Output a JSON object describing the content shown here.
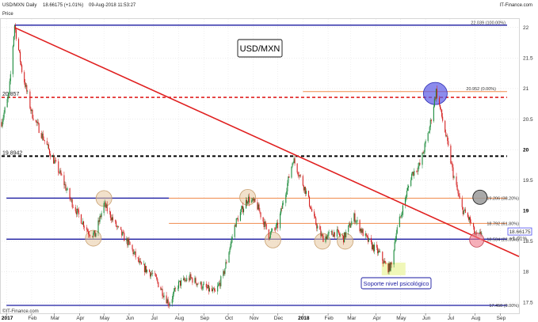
{
  "header": {
    "instrument": "USD/MXN",
    "period": "Daily",
    "quote": "18.66175 (+1.01%)",
    "datetime": "09-Aug-2018 11:53:27",
    "source": "IT-Finance.com",
    "axis_tag": "Price",
    "footer": "©IT-Finance.com"
  },
  "chart_data": {
    "type": "candlestick",
    "title": "USD/MXN",
    "ylim": [
      17.32,
      22.14
    ],
    "y_ticks": [
      17.5,
      18,
      18.5,
      19,
      19.5,
      20,
      20.5,
      21,
      21.5,
      22
    ],
    "y_tick_labels": [
      "17.5",
      "18",
      "18.5",
      "19",
      "19.5",
      "20",
      "20.5",
      "21",
      "21.5",
      "22"
    ],
    "x_labels": [
      "2017",
      "Feb",
      "Mar",
      "Apr",
      "May",
      "Jun",
      "Jul",
      "Aug",
      "Sep",
      "Oct",
      "Nov",
      "Dec",
      "2018",
      "Feb",
      "Mar",
      "Apr",
      "May",
      "Jun",
      "Jul",
      "Aug",
      "Sep"
    ],
    "x_range": [
      "2016-12-26",
      "2018-09-24"
    ],
    "price_path": [
      [
        "2016-12-26",
        20.45
      ],
      [
        "2017-01-04",
        20.9
      ],
      [
        "2017-01-11",
        22.04
      ],
      [
        "2017-01-20",
        21.3
      ],
      [
        "2017-02-01",
        20.6
      ],
      [
        "2017-02-15",
        20.2
      ],
      [
        "2017-03-01",
        19.8
      ],
      [
        "2017-03-10",
        19.55
      ],
      [
        "2017-03-20",
        19.2
      ],
      [
        "2017-04-01",
        18.9
      ],
      [
        "2017-04-12",
        18.65
      ],
      [
        "2017-04-20",
        18.6
      ],
      [
        "2017-05-01",
        19.1
      ],
      [
        "2017-05-08",
        18.95
      ],
      [
        "2017-05-18",
        18.7
      ],
      [
        "2017-06-01",
        18.45
      ],
      [
        "2017-06-15",
        18.1
      ],
      [
        "2017-07-01",
        17.95
      ],
      [
        "2017-07-15",
        17.6
      ],
      [
        "2017-07-20",
        17.48
      ],
      [
        "2017-08-01",
        17.8
      ],
      [
        "2017-08-15",
        17.9
      ],
      [
        "2017-09-01",
        17.75
      ],
      [
        "2017-09-15",
        17.65
      ],
      [
        "2017-09-25",
        17.95
      ],
      [
        "2017-10-10",
        18.8
      ],
      [
        "2017-10-25",
        19.2
      ],
      [
        "2017-11-05",
        19.1
      ],
      [
        "2017-11-20",
        18.6
      ],
      [
        "2017-12-01",
        18.75
      ],
      [
        "2017-12-20",
        19.85
      ],
      [
        "2018-01-05",
        19.3
      ],
      [
        "2018-01-15",
        18.85
      ],
      [
        "2018-01-25",
        18.55
      ],
      [
        "2018-02-10",
        18.65
      ],
      [
        "2018-02-20",
        18.55
      ],
      [
        "2018-03-05",
        18.9
      ],
      [
        "2018-03-15",
        18.65
      ],
      [
        "2018-03-25",
        18.45
      ],
      [
        "2018-04-05",
        18.3
      ],
      [
        "2018-04-15",
        18.05
      ],
      [
        "2018-04-20",
        18.1
      ],
      [
        "2018-04-25",
        18.6
      ],
      [
        "2018-05-05",
        19.1
      ],
      [
        "2018-05-15",
        19.6
      ],
      [
        "2018-05-25",
        19.75
      ],
      [
        "2018-06-05",
        20.3
      ],
      [
        "2018-06-14",
        20.96
      ],
      [
        "2018-06-25",
        20.3
      ],
      [
        "2018-07-05",
        19.6
      ],
      [
        "2018-07-15",
        19.05
      ],
      [
        "2018-07-25",
        18.85
      ],
      [
        "2018-08-01",
        18.6
      ],
      [
        "2018-08-05",
        18.55
      ],
      [
        "2018-08-09",
        18.66
      ]
    ],
    "horizontal_levels": [
      {
        "value": 22.039,
        "label": "22.039 (100.00%)",
        "color": "#1a1aa0",
        "style": "solid"
      },
      {
        "value": 20.857,
        "label": "20.857",
        "color": "#e02020",
        "style": "dashed"
      },
      {
        "value": 20.952,
        "label": "20.952 (0.00%)",
        "color": "#f08a4b",
        "style": "solid"
      },
      {
        "value": 19.8942,
        "label": "19.8942",
        "color": "#000000",
        "style": "dashed"
      },
      {
        "value": 19.206,
        "label": "19.206 (38.20%)",
        "color": "#f08a4b",
        "style": "solid"
      },
      {
        "value": 19.206,
        "label": "",
        "color": "#1a1aa0",
        "style": "solid"
      },
      {
        "value": 18.792,
        "label": "18.792 (61.80%)",
        "color": "#f08a4b",
        "style": "solid"
      },
      {
        "value": 18.534,
        "label": "18.534 (23.60%)",
        "color": "#1a1aa0",
        "style": "solid"
      },
      {
        "value": 17.45,
        "label": "17.450 (0.00%)",
        "color": "#1a1aa0",
        "style": "solid"
      }
    ],
    "trendline": {
      "from": [
        "2017-01-11",
        22.0
      ],
      "to": [
        "2018-09-24",
        18.25
      ],
      "color": "#e02020"
    },
    "current_price_label": "18.66175",
    "current_change_label": "+1.01%",
    "annotations": [
      "Soporte nivel psicológico"
    ]
  },
  "colors": {
    "up": "#1a8a3a",
    "down": "#d42020",
    "trendline": "#e02020",
    "support": "#1a1aa0",
    "fib": "#f08a4b",
    "price_badge": "#4a4af0",
    "change_text": "#18a018",
    "circle_tan": "#e8c9a0",
    "circle_blue": "#5a5ae6",
    "circle_grey": "#9a9a9a",
    "circle_red": "#f07a8a",
    "highlight_yellow": "#eef6b0"
  }
}
